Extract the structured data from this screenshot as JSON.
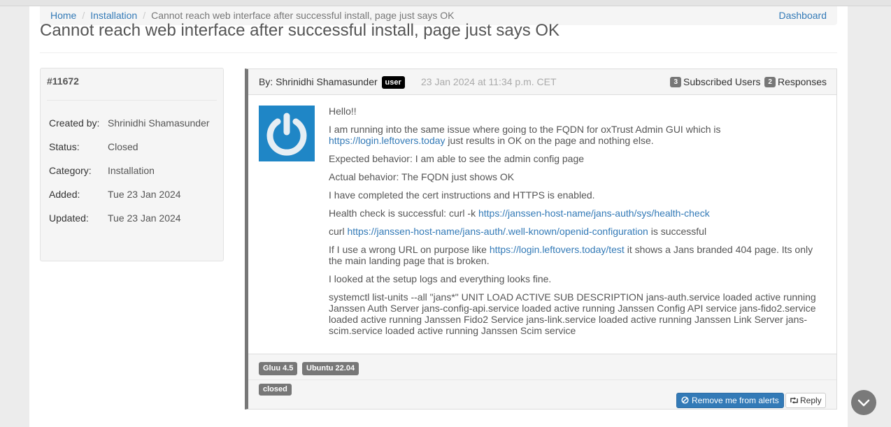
{
  "breadcrumb": {
    "home": "Home",
    "category": "Installation",
    "current": "Cannot reach web interface after successful install, page just says OK",
    "dashboard": "Dashboard"
  },
  "title": "Cannot reach web interface after successful install, page just says OK",
  "ticket": {
    "id": "#11672",
    "rows": [
      {
        "label": "Created by:",
        "value": "Shrinidhi Shamasunder"
      },
      {
        "label": "Status:",
        "value": "Closed"
      },
      {
        "label": "Category:",
        "value": "Installation"
      },
      {
        "label": "Added:",
        "value": "Tue 23 Jan 2024"
      },
      {
        "label": "Updated:",
        "value": "Tue 23 Jan 2024"
      }
    ]
  },
  "post": {
    "by_prefix": "By: ",
    "author": "Shrinidhi Shamasunder",
    "role": "user",
    "date": "23 Jan 2024 at 11:34 p.m. CET",
    "subscribed_count": "3",
    "subscribed_label": "Subscribed Users",
    "responses_count": "2",
    "responses_label": "Responses",
    "body": {
      "p1": "Hello!!",
      "p2a": "I am running into the same issue where going to the FQDN for oxTrust Admin GUI which is",
      "p2link": "https://login.leftovers.today",
      "p2b": " just results in OK on the page and nothing else.",
      "p3": "Expected behavior: I am able to see the admin config page",
      "p4": "Actual behavior: The FQDN just shows OK",
      "p5": "I have completed the cert instructions and HTTPS is enabled.",
      "p6a": "Health check is successful: curl -k ",
      "p6link": "https://janssen-host-name/jans-auth/sys/health-check",
      "p7a": "curl ",
      "p7link": "https://janssen-host-name/jans-auth/.well-known/openid-configuration",
      "p7b": " is successful",
      "p8a": "If I use a wrong URL on purpose like ",
      "p8link": "https://login.leftovers.today/test",
      "p8b": " it shows a Jans branded 404 page. Its only the main landing page that is broken.",
      "p9": "I looked at the setup logs and everything looks fine.",
      "p10": "systemctl list-units --all \"jans*\" UNIT LOAD ACTIVE SUB DESCRIPTION jans-auth.service loaded active running Janssen Auth Server jans-config-api.service loaded active running Janssen Config API service jans-fido2.service loaded active running Janssen Fido2 Service jans-link.service loaded active running Janssen Link Server jans-scim.service loaded active running Janssen Scim service"
    },
    "tags": [
      "Gluu 4.5",
      "Ubuntu 22.04"
    ],
    "status_label": "closed",
    "alerts_button": "Remove me from alerts",
    "reply_button": "Reply"
  },
  "colors": {
    "link": "#337ab7",
    "avatar_bg": "#1f86c6",
    "primary_button": "#337ab7"
  },
  "icons": [
    "power-icon",
    "ban-icon",
    "retweet-icon",
    "chevron-down-icon"
  ]
}
